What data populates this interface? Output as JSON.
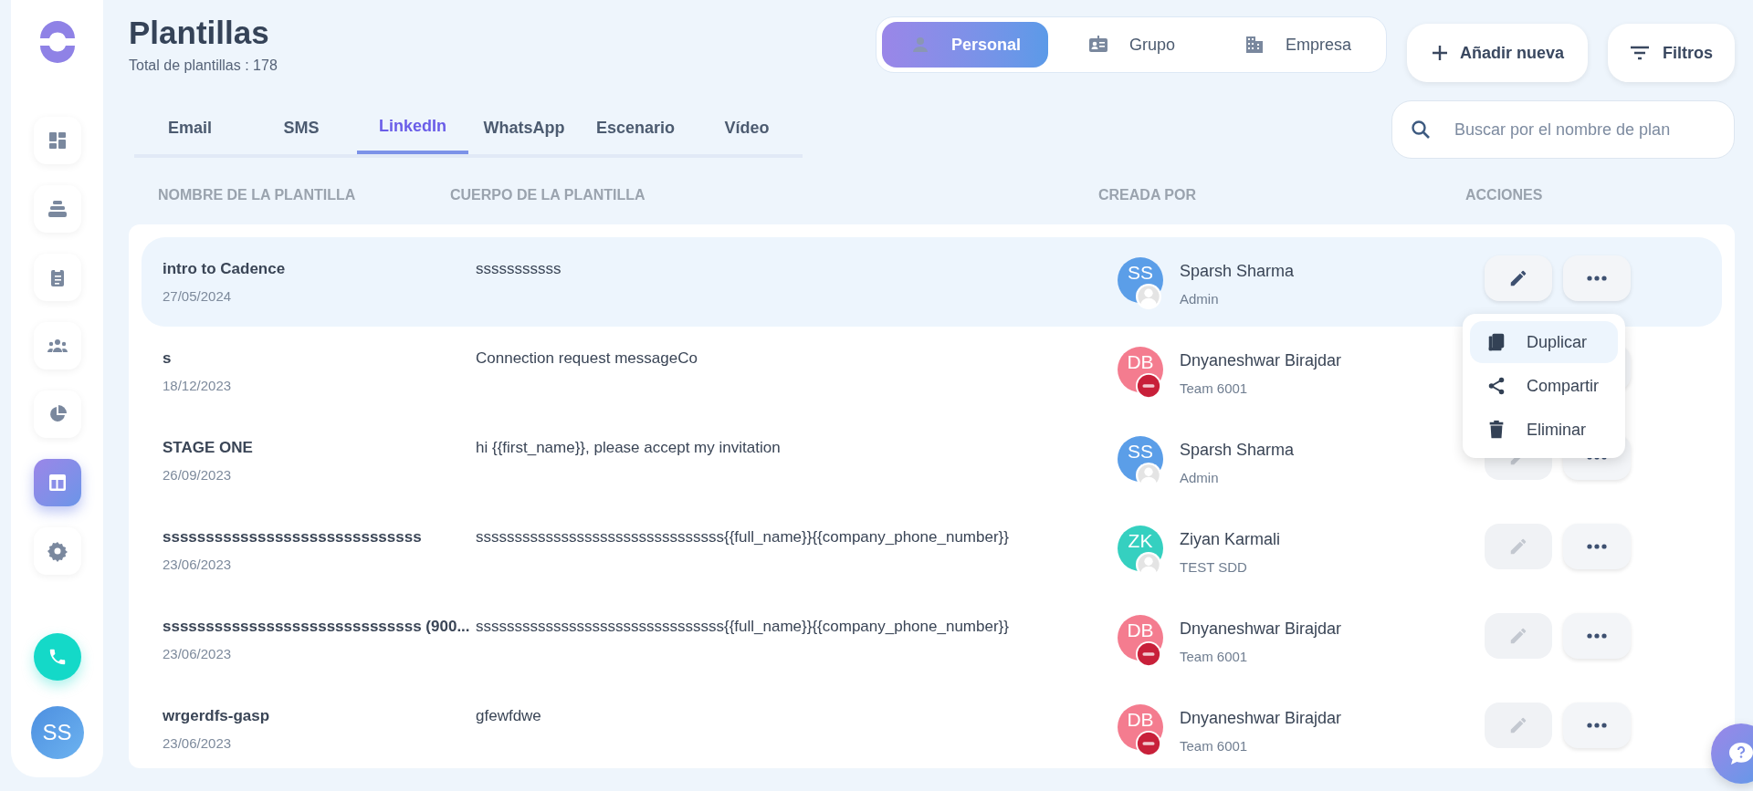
{
  "sidebar": {
    "items": [
      {
        "selected": false
      },
      {
        "selected": false
      },
      {
        "selected": false
      },
      {
        "selected": false
      },
      {
        "selected": false
      },
      {
        "selected": true
      },
      {
        "selected": false
      }
    ],
    "user_avatar": "SS"
  },
  "header": {
    "title": "Plantillas",
    "subtitle": "Total de plantillas : 178"
  },
  "scope_tabs": [
    {
      "label": "Personal",
      "selected": true
    },
    {
      "label": "Grupo",
      "selected": false
    },
    {
      "label": "Empresa",
      "selected": false
    }
  ],
  "add_button": "Añadir nueva",
  "filter_button": "Filtros",
  "channel_tabs": [
    {
      "label": "Email",
      "selected": false
    },
    {
      "label": "SMS",
      "selected": false
    },
    {
      "label": "LinkedIn",
      "selected": true
    },
    {
      "label": "WhatsApp",
      "selected": false
    },
    {
      "label": "Escenario",
      "selected": false
    },
    {
      "label": "Vídeo",
      "selected": false
    }
  ],
  "search": {
    "placeholder": "Buscar por el nombre de plan"
  },
  "table": {
    "columns": [
      "NOMBRE DE LA PLANTILLA",
      "CUERPO DE LA PLANTILLA",
      "CREADA POR",
      "ACCIONES"
    ],
    "rows": [
      {
        "name": "intro to Cadence",
        "date": "27/05/2024",
        "body": "sssssssssss",
        "creator": {
          "initials": "SS",
          "name": "Sparsh Sharma",
          "role": "Admin",
          "color": "#5b9ee8",
          "kind": "user"
        },
        "selected": true,
        "edit_disabled": false
      },
      {
        "name": "s",
        "date": "18/12/2023",
        "body": "Connection request messageCo",
        "creator": {
          "initials": "DB",
          "name": "Dnyaneshwar Birajdar",
          "role": "Team 6001",
          "color": "#f47c8f",
          "kind": "team"
        },
        "selected": false
      },
      {
        "name": "STAGE ONE",
        "date": "26/09/2023",
        "body": "hi {{first_name}}, please accept my invitation",
        "creator": {
          "initials": "SS",
          "name": "Sparsh Sharma",
          "role": "Admin",
          "color": "#5b9ee8",
          "kind": "user"
        },
        "selected": false,
        "edit_disabled": true
      },
      {
        "name": "ssssssssssssssssssssssssssssss",
        "date": "23/06/2023",
        "body": "ssssssssssssssssssssssssssssssss{{full_name}}{{company_phone_number}}",
        "creator": {
          "initials": "ZK",
          "name": "Ziyan Karmali",
          "role": "TEST SDD",
          "color": "#35d0c0",
          "kind": "user"
        },
        "selected": false,
        "edit_disabled": true
      },
      {
        "name": "ssssssssssssssssssssssssssssss (900...",
        "date": "23/06/2023",
        "body": "ssssssssssssssssssssssssssssssss{{full_name}}{{company_phone_number}}",
        "creator": {
          "initials": "DB",
          "name": "Dnyaneshwar Birajdar",
          "role": "Team 6001",
          "color": "#f47c8f",
          "kind": "team"
        },
        "selected": false,
        "edit_disabled": true
      },
      {
        "name": "wrgerdfs-gasp",
        "date": "23/06/2023",
        "body": "gfewfdwe",
        "creator": {
          "initials": "DB",
          "name": "Dnyaneshwar Birajdar",
          "role": "Team 6001",
          "color": "#f47c8f",
          "kind": "team"
        },
        "selected": false,
        "edit_disabled": true
      }
    ]
  },
  "row_menu": {
    "items": [
      {
        "label": "Duplicar",
        "selected": true
      },
      {
        "label": "Compartir",
        "selected": false
      },
      {
        "label": "Eliminar",
        "selected": false
      }
    ]
  }
}
